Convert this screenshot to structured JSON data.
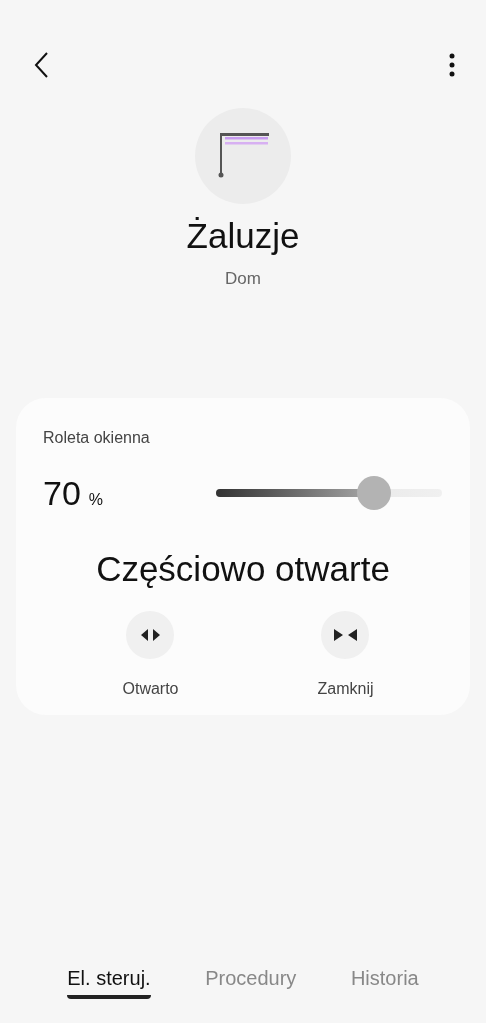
{
  "device": {
    "name": "Żaluzje",
    "location": "Dom"
  },
  "card": {
    "label": "Roleta okienna",
    "value": "70",
    "unit": "%",
    "level": 0.7,
    "status": "Częściowo otwarte",
    "actions": [
      {
        "kind": "open",
        "label": "Otwarto"
      },
      {
        "kind": "close",
        "label": "Zamknij"
      }
    ]
  },
  "tabs": [
    {
      "label": "El. steruj.",
      "selected": true
    },
    {
      "label": "Procedury",
      "selected": false
    },
    {
      "label": "Historia",
      "selected": false
    }
  ]
}
